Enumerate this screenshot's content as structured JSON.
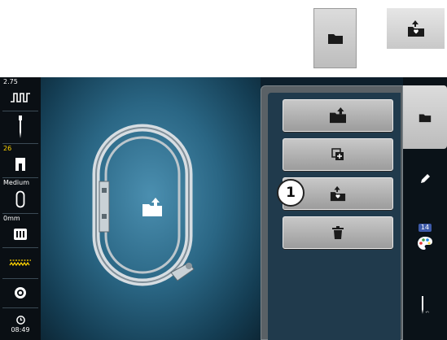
{
  "reference_icons": {
    "folder": "folder-icon",
    "save_favorite": "favorite-save-icon"
  },
  "status_bar": {
    "thread_tension": {
      "value": "2.75",
      "icon": "tension-icon"
    },
    "needle": {
      "icon": "needle-icon"
    },
    "presser_foot": {
      "value": "26",
      "icon": "presser-foot-icon"
    },
    "hoop_size": {
      "label": "Medium",
      "icon": "hoop-icon"
    },
    "feed_dog": {
      "label": "0mm",
      "icon": "stitch-plate-icon"
    },
    "stitch": {
      "icon": "stitch-pattern-icon"
    },
    "bobbin": {
      "icon": "bobbin-icon"
    },
    "clock": {
      "time": "08:49",
      "icon": "clock-icon"
    }
  },
  "work_area": {
    "hoop_icon": "embroidery-hoop",
    "center_icon": "folder-upload-icon"
  },
  "menu": {
    "buttons": [
      {
        "icon": "folder-upload-icon"
      },
      {
        "icon": "duplicate-icon"
      },
      {
        "icon": "save-favorite-icon",
        "callout": "1"
      },
      {
        "icon": "trash-icon"
      }
    ]
  },
  "tabs": {
    "file": "folder-icon",
    "edit": "pencil-icon",
    "color": {
      "icon": "palette-icon",
      "badge": "14"
    },
    "stitch": "needle-info-icon"
  },
  "colors": {
    "accent_yellow": "#ffd400",
    "panel_bg": "#203a4c",
    "button_gray": "#b4b4b4"
  }
}
